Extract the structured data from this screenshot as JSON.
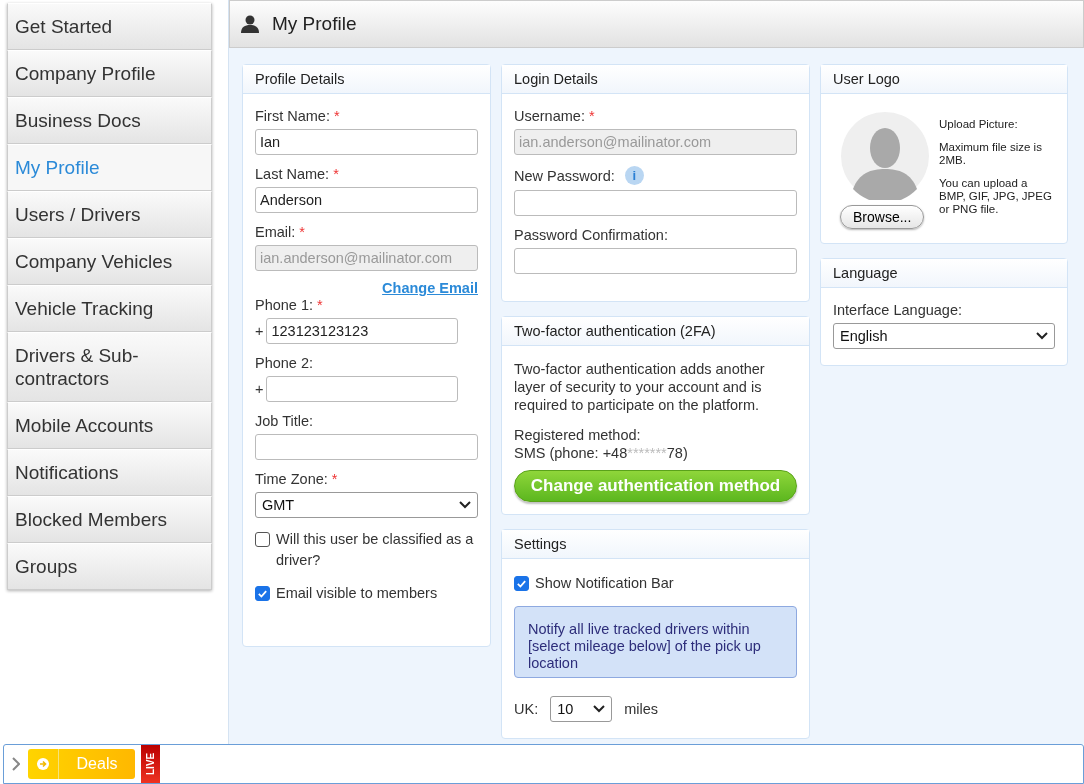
{
  "sidebar": {
    "items": [
      {
        "label": "Get Started",
        "selected": false
      },
      {
        "label": "Company Profile",
        "selected": false
      },
      {
        "label": "Business Docs",
        "selected": false
      },
      {
        "label": "My Profile",
        "selected": true
      },
      {
        "label": "Users / Drivers",
        "selected": false
      },
      {
        "label": "Company Vehicles",
        "selected": false
      },
      {
        "label": "Vehicle Tracking",
        "selected": false
      },
      {
        "label": "Drivers & Sub-contractors",
        "selected": false
      },
      {
        "label": "Mobile Accounts",
        "selected": false
      },
      {
        "label": "Notifications",
        "selected": false
      },
      {
        "label": "Blocked Members",
        "selected": false
      },
      {
        "label": "Groups",
        "selected": false
      }
    ]
  },
  "page": {
    "title": "My Profile"
  },
  "profile_details": {
    "title": "Profile Details",
    "items": [
      {
        "kind": "text",
        "label": "First Name:",
        "mark": "*",
        "value": "Ian",
        "disabled": false
      },
      {
        "kind": "text",
        "label": "Last Name:",
        "mark": "*",
        "value": "Anderson",
        "disabled": false
      },
      {
        "kind": "text",
        "label": "Email:",
        "mark": "*",
        "value": "ian.anderson@mailinator.com",
        "disabled": true
      },
      {
        "kind": "link",
        "label": "Change Email"
      },
      {
        "kind": "phone",
        "label": "Phone 1:",
        "mark": "*",
        "prefix": "+",
        "value": "123123123123"
      },
      {
        "kind": "phone",
        "label": "Phone 2:",
        "prefix": "+"
      },
      {
        "kind": "text",
        "label": "Job Title:",
        "disabled": false
      },
      {
        "kind": "select",
        "label": "Time Zone:",
        "mark": "*",
        "value": "GMT"
      },
      {
        "kind": "checkbox",
        "label": "Will this user be classified as a driver?",
        "checked": false
      },
      {
        "kind": "checkbox",
        "label": "Email visible to members",
        "checked": true
      }
    ]
  },
  "login_details": {
    "title": "Login Details",
    "items": [
      {
        "kind": "text",
        "label": "Username:",
        "mark": "*",
        "value": "ian.anderson@mailinator.com",
        "disabled": true
      },
      {
        "kind": "text",
        "label": "New Password:",
        "info": "i",
        "disabled": false
      },
      {
        "kind": "text",
        "label": "Password Confirmation:",
        "disabled": false
      }
    ]
  },
  "two_factor": {
    "title": "Two-factor authentication (2FA)",
    "description": "Two-factor authentication adds another layer of security to your account and is required to participate on the platform.",
    "method_label": "Registered method:",
    "method_prefix": "SMS (phone: +48",
    "method_masked": "*******",
    "method_suffix": "78)",
    "button": "Change authentication method"
  },
  "settings": {
    "title": "Settings",
    "checkbox": {
      "label": "Show Notification Bar",
      "checked": true
    },
    "notice": "Notify all live tracked drivers within [select mileage below] of the pick up location",
    "mileage": {
      "label": "UK:",
      "value": "10",
      "unit": "miles"
    }
  },
  "user_logo": {
    "title": "User Logo",
    "texts": [
      "Upload Picture:",
      "Maximum file size is 2MB.",
      "You can upload a BMP, GIF, JPG, JPEG or PNG file."
    ],
    "button": "Browse..."
  },
  "language": {
    "title": "Language",
    "label": "Interface Language:",
    "value": "English"
  },
  "bottom_bar": {
    "deals": "Deals",
    "live": "LIVE"
  }
}
